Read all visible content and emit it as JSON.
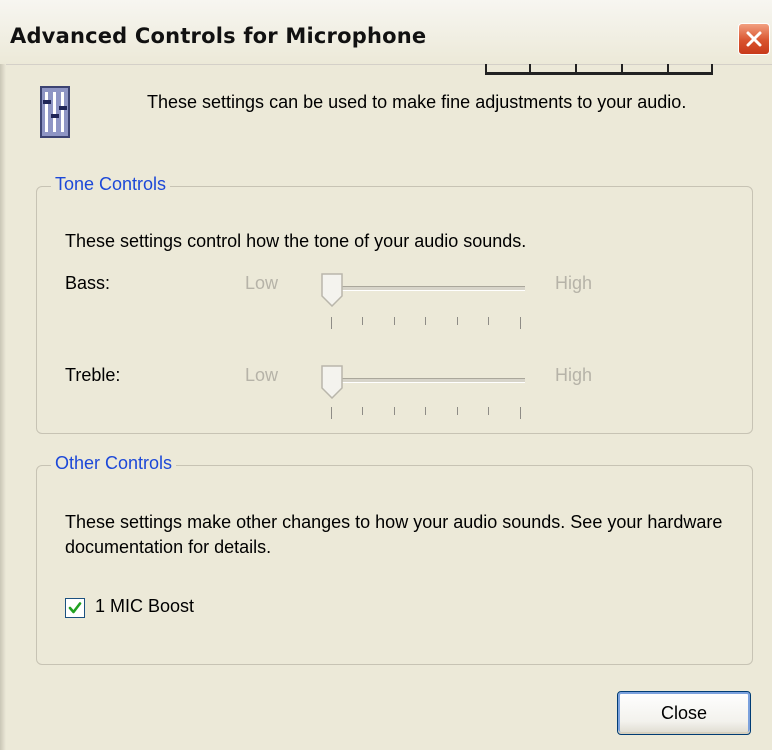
{
  "window": {
    "title": "Advanced Controls for Microphone",
    "title_color": "#111111",
    "close_icon": "close-icon"
  },
  "header": {
    "icon": "mixer-settings-icon",
    "text": "These settings can be used to make fine adjustments to your audio."
  },
  "tone_controls": {
    "label": "Tone Controls",
    "description": "These settings control how the tone of your audio sounds.",
    "sliders": [
      {
        "label": "Bass:",
        "low": "Low",
        "high": "High",
        "value": 0.0,
        "enabled": false
      },
      {
        "label": "Treble:",
        "low": "Low",
        "high": "High",
        "value": 0.0,
        "enabled": false
      }
    ]
  },
  "other_controls": {
    "label": "Other Controls",
    "description": "These settings make other changes to how your audio sounds.  See your hardware documentation for details.",
    "checkbox": {
      "label": "1  MIC Boost",
      "checked": true
    }
  },
  "buttons": {
    "close": "Close"
  },
  "colors": {
    "dialog_background": "#ece9d8",
    "group_label": "#1c48d8",
    "disabled_text": "#b6b3a8",
    "close_button_red": "#d9542f",
    "checkmark_green": "#21a121"
  }
}
